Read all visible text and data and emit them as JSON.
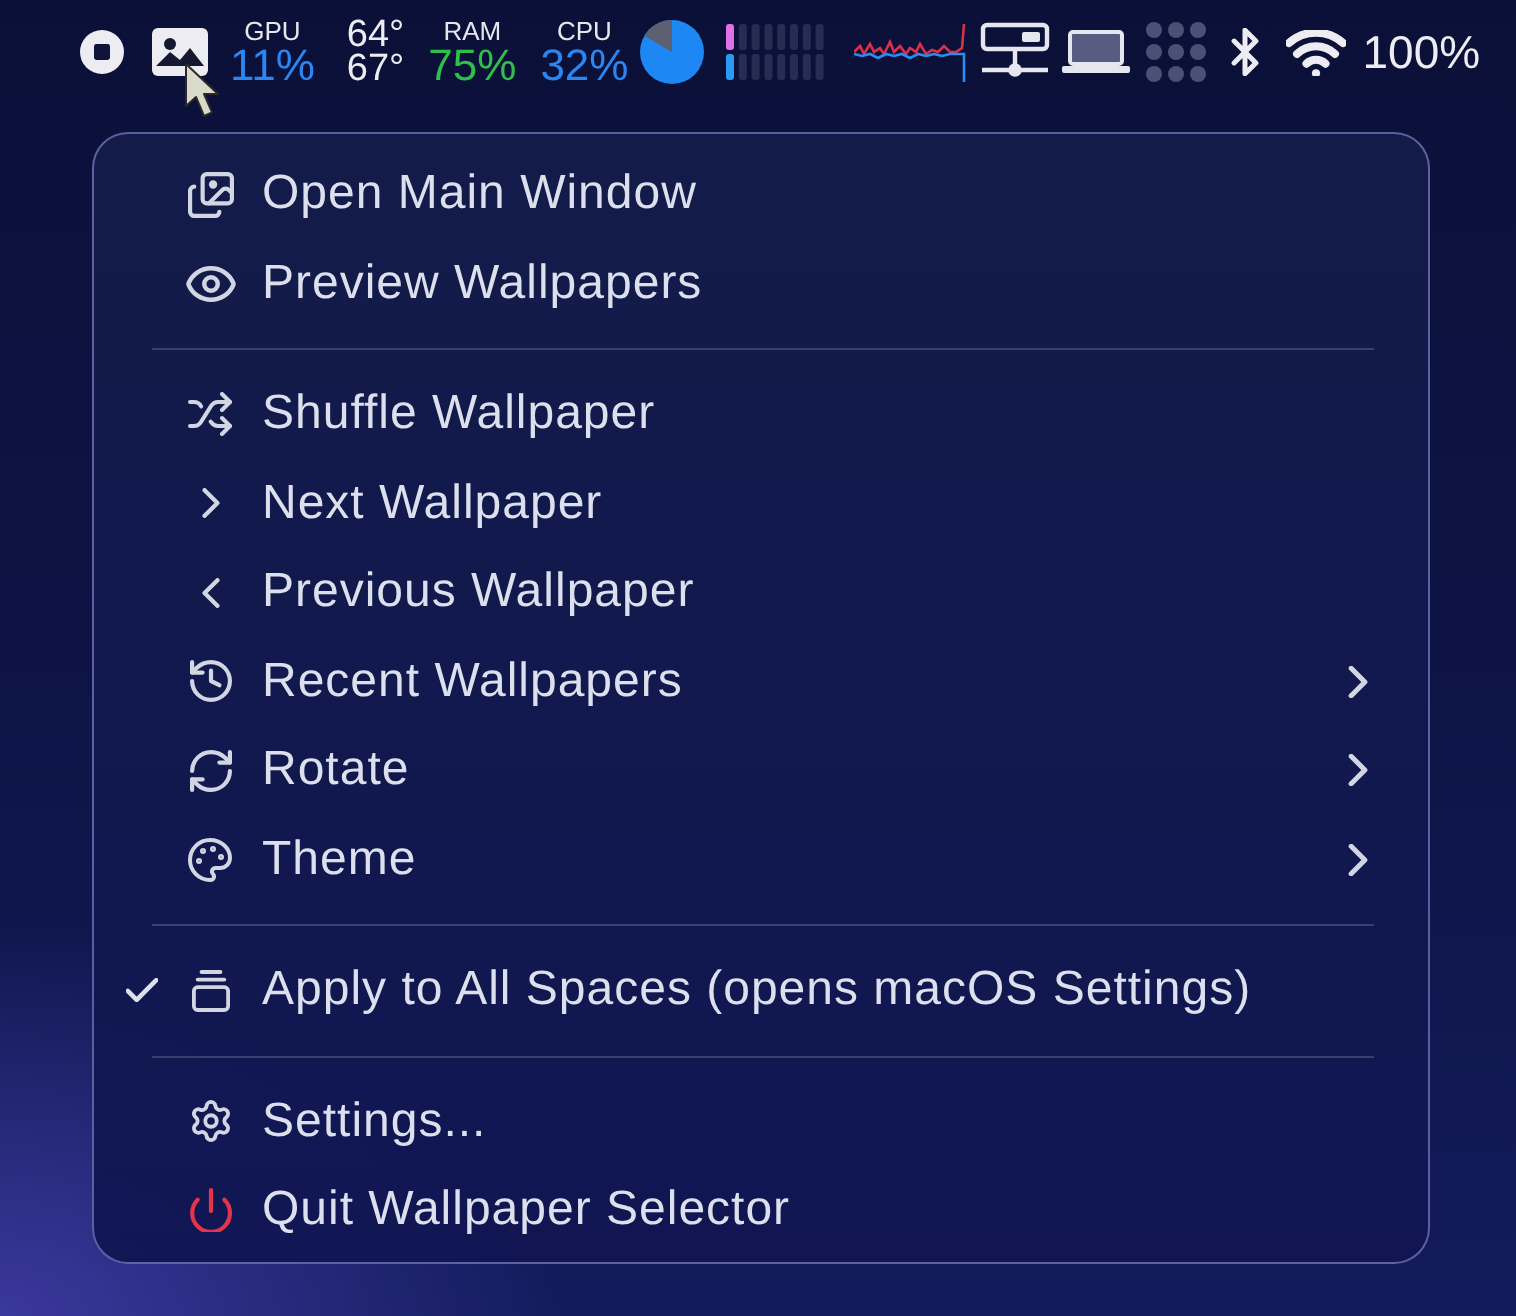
{
  "menu_bar": {
    "stats": [
      {
        "kind": "percent",
        "label": "GPU",
        "value": "11%",
        "color": "#2b86f2"
      },
      {
        "kind": "temperature",
        "values": [
          "64°",
          "67°"
        ]
      },
      {
        "kind": "percent",
        "label": "RAM",
        "value": "75%",
        "color": "#2fbf4a"
      },
      {
        "kind": "percent",
        "label": "CPU",
        "value": "32%",
        "color": "#2b86f2"
      }
    ],
    "battery": "100%"
  },
  "menu": {
    "sections": [
      {
        "items": [
          {
            "label": "Open Main Window",
            "checked": false,
            "submenu": false
          },
          {
            "label": "Preview Wallpapers",
            "checked": false,
            "submenu": false
          }
        ]
      },
      {
        "items": [
          {
            "label": "Shuffle Wallpaper",
            "checked": false,
            "submenu": false
          },
          {
            "label": "Next Wallpaper",
            "checked": false,
            "submenu": false
          },
          {
            "label": "Previous Wallpaper",
            "checked": false,
            "submenu": false
          },
          {
            "label": "Recent Wallpapers",
            "checked": false,
            "submenu": true
          },
          {
            "label": "Rotate",
            "checked": false,
            "submenu": true
          },
          {
            "label": "Theme",
            "checked": false,
            "submenu": true
          }
        ]
      },
      {
        "items": [
          {
            "label": "Apply to All Spaces (opens macOS Settings)",
            "checked": true,
            "submenu": false
          }
        ]
      },
      {
        "items": [
          {
            "label": "Settings...",
            "checked": false,
            "submenu": false
          },
          {
            "label": "Quit Wallpaper Selector",
            "checked": false,
            "submenu": false
          }
        ]
      }
    ]
  }
}
